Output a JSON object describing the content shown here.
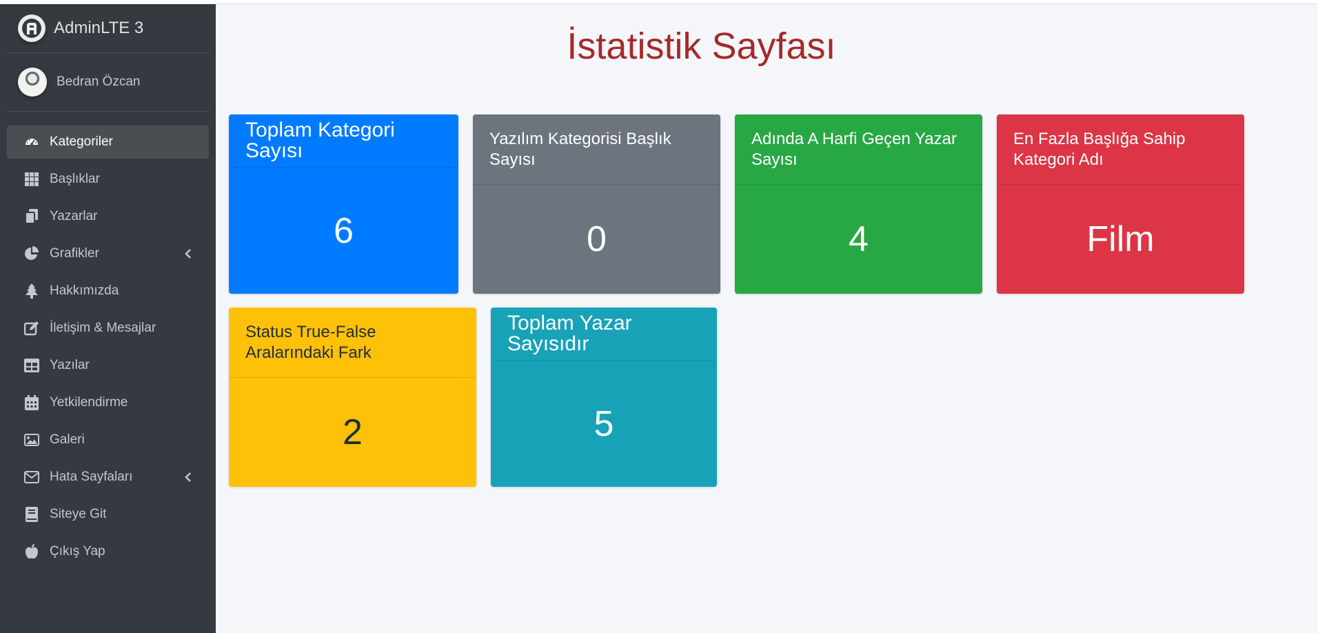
{
  "brand": {
    "name": "AdminLTE 3"
  },
  "user": {
    "name": "Bedran Özcan"
  },
  "sidebar": {
    "items": [
      {
        "label": "Kategoriler",
        "icon": "tachometer-icon",
        "active": true
      },
      {
        "label": "Başlıklar",
        "icon": "grid-icon"
      },
      {
        "label": "Yazarlar",
        "icon": "copy-icon"
      },
      {
        "label": "Grafikler",
        "icon": "pie-chart-icon",
        "has_submenu": true
      },
      {
        "label": "Hakkımızda",
        "icon": "tree-icon"
      },
      {
        "label": "İletişim & Mesajlar",
        "icon": "edit-icon"
      },
      {
        "label": "Yazılar",
        "icon": "table-icon"
      },
      {
        "label": "Yetkilendirme",
        "icon": "calendar-icon"
      },
      {
        "label": "Galeri",
        "icon": "image-icon"
      },
      {
        "label": "Hata Sayfaları",
        "icon": "envelope-icon",
        "has_submenu": true
      },
      {
        "label": "Siteye Git",
        "icon": "book-icon"
      },
      {
        "label": "Çıkış Yap",
        "icon": "apple-icon"
      }
    ]
  },
  "page": {
    "title": "İstatistik Sayfası"
  },
  "stats": [
    {
      "title": "Toplam Kategori Sayısı",
      "value": "6",
      "color": "#007bff"
    },
    {
      "title": "Yazılım Kategorisi Başlık Sayısı",
      "value": "0",
      "color": "#6c757d"
    },
    {
      "title": "Adında A Harfi Geçen Yazar Sayısı",
      "value": "4",
      "color": "#28a745"
    },
    {
      "title": "En Fazla Başlığa Sahip Kategori Adı",
      "value": "Film",
      "color": "#dc3545"
    },
    {
      "title": "Status True-False Aralarındaki Fark",
      "value": "2",
      "color": "#ffc107"
    },
    {
      "title": "Toplam Yazar Sayısıdır",
      "value": "5",
      "color": "#17a2b8"
    }
  ]
}
